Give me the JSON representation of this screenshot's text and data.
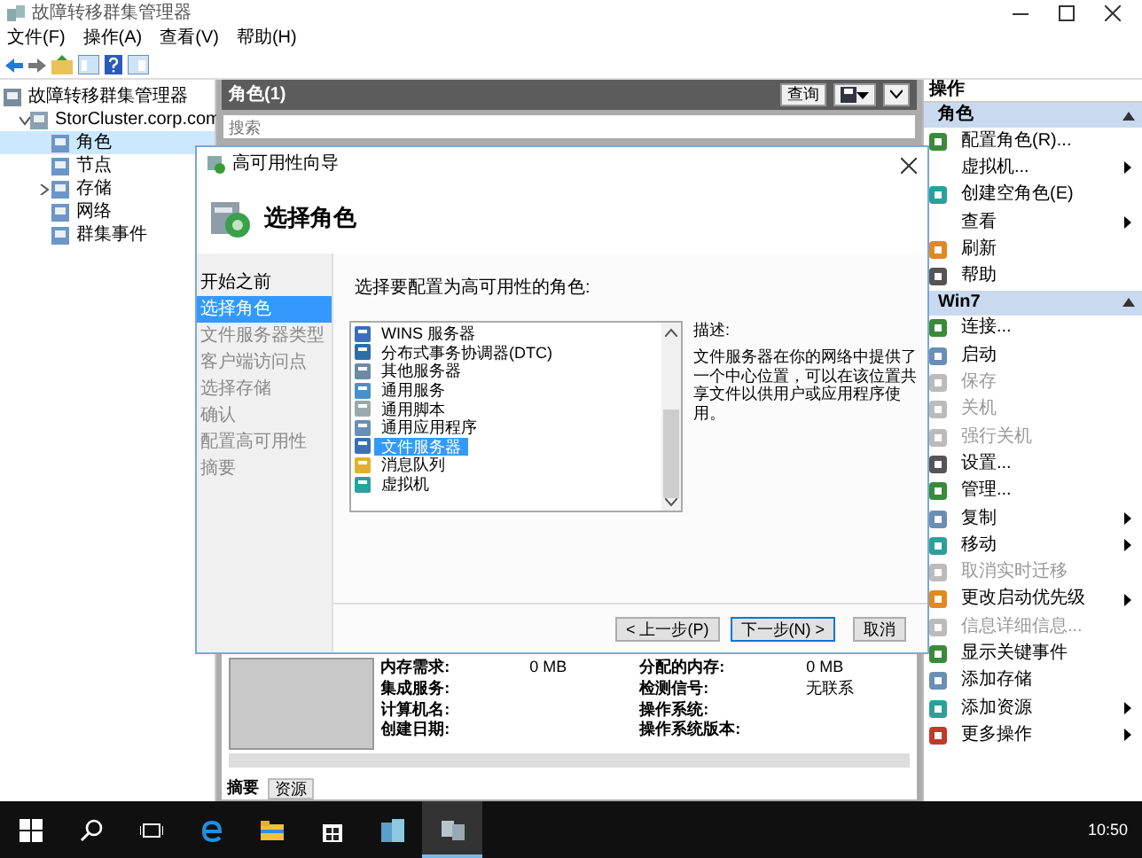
{
  "window": {
    "title": "故障转移群集管理器"
  },
  "menu": [
    "文件(F)",
    "操作(A)",
    "查看(V)",
    "帮助(H)"
  ],
  "tree": [
    {
      "label": "故障转移群集管理器",
      "selected": false,
      "children": [
        {
          "label": "StorCluster.corp.com",
          "selected": false,
          "expanded": true,
          "children": [
            {
              "label": "角色",
              "selected": true
            },
            {
              "label": "节点",
              "selected": false
            },
            {
              "label": "存储",
              "selected": false,
              "expanded": false
            },
            {
              "label": "网络",
              "selected": false
            },
            {
              "label": "群集事件",
              "selected": false
            }
          ]
        }
      ]
    }
  ],
  "center": {
    "title": "角色(1)",
    "query_button": "查询",
    "search": {
      "placeholder": "搜索"
    },
    "details": [
      {
        "label": "内存需求:",
        "value": "0 MB",
        "label_2": "分配的内存:",
        "value_2": "0 MB"
      },
      {
        "label": "集成服务:",
        "label_2": "检测信号:",
        "value_2": "无联系"
      },
      {
        "label": "计算机名:",
        "label_2": "操作系统:"
      },
      {
        "label": "创建日期:",
        "label_2": "操作系统版本:"
      }
    ],
    "tabs": [
      {
        "label": "摘要",
        "selected": true
      },
      {
        "label": "资源",
        "selected": false
      }
    ]
  },
  "actions": {
    "title": "操作",
    "sections": [
      {
        "title": "角色",
        "items": [
          {
            "label": "配置角色(R)...",
            "icon": true,
            "disabled": false,
            "submenu": false
          },
          {
            "label": "虚拟机...",
            "icon": false,
            "disabled": false,
            "submenu": true
          },
          {
            "label": "创建空角色(E)",
            "icon": true,
            "disabled": false,
            "submenu": false
          },
          {
            "label": "查看",
            "icon": false,
            "disabled": false,
            "submenu": true
          },
          {
            "label": "刷新",
            "icon": true,
            "disabled": false,
            "submenu": false
          },
          {
            "label": "帮助",
            "icon": true,
            "disabled": false,
            "submenu": false
          }
        ]
      },
      {
        "title": "Win7",
        "items": [
          {
            "label": "连接...",
            "icon": true,
            "disabled": false,
            "submenu": false
          },
          {
            "label": "启动",
            "icon": true,
            "disabled": false,
            "submenu": false
          },
          {
            "label": "保存",
            "icon": true,
            "disabled": true,
            "submenu": false
          },
          {
            "label": "关机",
            "icon": true,
            "disabled": true,
            "submenu": false
          },
          {
            "label": "强行关机",
            "icon": true,
            "disabled": true,
            "submenu": false
          },
          {
            "label": "设置...",
            "icon": true,
            "disabled": false,
            "submenu": false
          },
          {
            "label": "管理...",
            "icon": true,
            "disabled": false,
            "submenu": false
          },
          {
            "label": "复制",
            "icon": true,
            "disabled": false,
            "submenu": true
          },
          {
            "label": "移动",
            "icon": true,
            "disabled": false,
            "submenu": true
          },
          {
            "label": "取消实时迁移",
            "icon": true,
            "disabled": true,
            "submenu": false
          },
          {
            "label": "更改启动优先级",
            "icon": true,
            "disabled": false,
            "submenu": true
          },
          {
            "label": "信息详细信息...",
            "icon": true,
            "disabled": true,
            "submenu": false
          },
          {
            "label": "显示关键事件",
            "icon": true,
            "disabled": false,
            "submenu": false
          },
          {
            "label": "添加存储",
            "icon": true,
            "disabled": false,
            "submenu": false
          },
          {
            "label": "添加资源",
            "icon": true,
            "disabled": false,
            "submenu": true
          },
          {
            "label": "更多操作",
            "icon": true,
            "disabled": false,
            "submenu": true
          }
        ]
      }
    ]
  },
  "dialog": {
    "title": "高可用性向导",
    "heading": "选择角色",
    "steps": [
      {
        "label": "开始之前",
        "selected": false,
        "disabled": false
      },
      {
        "label": "选择角色",
        "selected": true,
        "disabled": false
      },
      {
        "label": "文件服务器类型",
        "selected": false,
        "disabled": true
      },
      {
        "label": "客户端访问点",
        "selected": false,
        "disabled": true
      },
      {
        "label": "选择存储",
        "selected": false,
        "disabled": true
      },
      {
        "label": "确认",
        "selected": false,
        "disabled": true
      },
      {
        "label": "配置高可用性",
        "selected": false,
        "disabled": true
      },
      {
        "label": "摘要",
        "selected": false,
        "disabled": true
      }
    ],
    "prompt": "选择要配置为高可用性的角色:",
    "roles": [
      {
        "label": "WINS 服务器",
        "selected": false
      },
      {
        "label": "分布式事务协调器(DTC)",
        "selected": false
      },
      {
        "label": "其他服务器",
        "selected": false
      },
      {
        "label": "通用服务",
        "selected": false
      },
      {
        "label": "通用脚本",
        "selected": false
      },
      {
        "label": "通用应用程序",
        "selected": false
      },
      {
        "label": "文件服务器",
        "selected": true
      },
      {
        "label": "消息队列",
        "selected": false
      },
      {
        "label": "虚拟机",
        "selected": false
      }
    ],
    "description_label": "描述:",
    "description": "文件服务器在你的网络中提供了一个中心位置，可以在该位置共享文件以供用户或应用程序使用。",
    "buttons": [
      {
        "label": "< 上一步(P)",
        "kind": "normal"
      },
      {
        "label": "下一步(N) >",
        "kind": "default"
      },
      {
        "label": "取消",
        "kind": "normal"
      }
    ]
  },
  "taskbar": {
    "apps": [
      {
        "kind": "start",
        "active": false
      },
      {
        "kind": "search",
        "active": false
      },
      {
        "kind": "taskview",
        "active": false
      },
      {
        "kind": "browser",
        "active": false
      },
      {
        "kind": "folder",
        "active": false
      },
      {
        "kind": "store",
        "active": false
      },
      {
        "kind": "server",
        "active": false
      },
      {
        "kind": "cluster",
        "active": true
      }
    ],
    "clock": "10:50"
  }
}
